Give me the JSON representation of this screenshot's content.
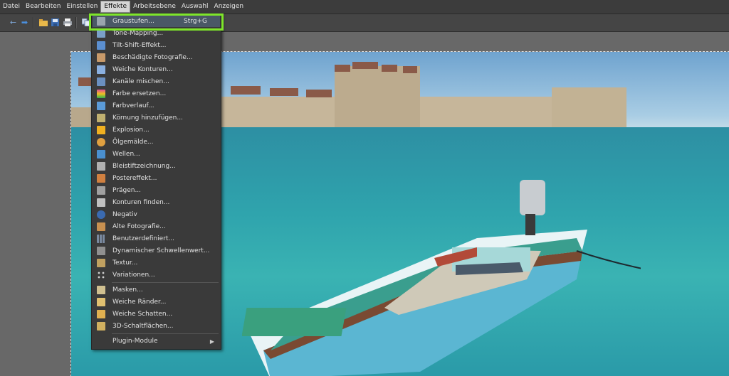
{
  "menubar": {
    "items": [
      "Datei",
      "Bearbeiten",
      "Einstellen",
      "Effekte",
      "Arbeitsebene",
      "Auswahl",
      "Anzeigen"
    ],
    "active": "Effekte"
  },
  "toolbar": {
    "icons": [
      "undo-icon",
      "redo-icon",
      "open-folder-icon",
      "save-icon",
      "print-icon",
      "copy-icon"
    ]
  },
  "effects_menu": {
    "items": [
      {
        "label": "Graustufen...",
        "shortcut": "Strg+G",
        "icon_color": "#9aa4ae"
      },
      {
        "label": "Tone-Mapping...",
        "icon_color": "#7aa0c8"
      },
      {
        "label": "Tilt-Shift-Effekt...",
        "icon_color": "#5b8fd0"
      },
      {
        "label": "Beschädigte Fotografie...",
        "icon_color": "#c89a6a"
      },
      {
        "label": "Weiche Konturen...",
        "icon_color": "#8ab0e0"
      },
      {
        "label": "Kanäle mischen...",
        "icon_color": "#6a8fc0"
      },
      {
        "label": "Farbe ersetzen...",
        "icon_color": "#e04a9a"
      },
      {
        "label": "Farbverlauf...",
        "icon_color": "#5b9bd8"
      },
      {
        "label": "Körnung hinzufügen...",
        "icon_color": "#c0b070"
      },
      {
        "label": "Explosion...",
        "icon_color": "#f0b020"
      },
      {
        "label": "Ölgemälde...",
        "icon_color": "#e0a040"
      },
      {
        "label": "Wellen...",
        "icon_color": "#4a90d0"
      },
      {
        "label": "Bleistiftzeichnung...",
        "icon_color": "#b0b0b0"
      },
      {
        "label": "Postereffekt...",
        "icon_color": "#d08040"
      },
      {
        "label": "Prägen...",
        "icon_color": "#a0a0a0"
      },
      {
        "label": "Konturen finden...",
        "icon_color": "#c0c0c0"
      },
      {
        "label": "Negativ",
        "icon_color": "#3a6ab0"
      },
      {
        "label": "Alte Fotografie...",
        "icon_color": "#c89050"
      },
      {
        "label": "Benutzerdefiniert...",
        "icon_color": "#7a8aa0"
      },
      {
        "label": "Dynamischer Schwellenwert...",
        "icon_color": "#909090"
      },
      {
        "label": "Textur...",
        "icon_color": "#c0a060"
      },
      {
        "label": "Variationen...",
        "icon_color": "#d0d0d0"
      },
      {
        "label": "Masken...",
        "icon_color": "#d0c090"
      },
      {
        "label": "Weiche Ränder...",
        "icon_color": "#e0c070"
      },
      {
        "label": "Weiche Schatten...",
        "icon_color": "#e0b050"
      },
      {
        "label": "3D-Schaltflächen...",
        "icon_color": "#d0b060"
      },
      {
        "label": "Plugin-Module"
      }
    ]
  },
  "highlight_color": "#7ee62a"
}
